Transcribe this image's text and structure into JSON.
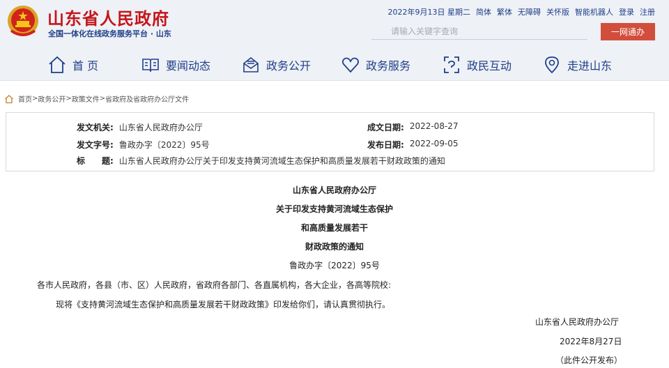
{
  "header": {
    "site_title": "山东省人民政府",
    "site_subtitle": "全国一体化在线政务服务平台 · 山东",
    "top_links": {
      "date": "2022年9月13日 星期二",
      "simplified": "简体",
      "traditional": "繁体",
      "accessible": "无障碍",
      "care": "关怀版",
      "robot": "智能机器人",
      "login": "登录",
      "register": "注册"
    },
    "search": {
      "placeholder": "请输入关键字查询",
      "button_label": "一网通办"
    }
  },
  "nav": {
    "items": [
      {
        "label": "首 页",
        "icon": "home-icon"
      },
      {
        "label": "要闻动态",
        "icon": "book-icon"
      },
      {
        "label": "政务公开",
        "icon": "inbox-icon"
      },
      {
        "label": "政务服务",
        "icon": "heart-icon"
      },
      {
        "label": "政民互动",
        "icon": "interaction-icon"
      },
      {
        "label": "走进山东",
        "icon": "location-icon"
      }
    ]
  },
  "breadcrumb": {
    "items": [
      "首页",
      "政务公开",
      "政策文件",
      "省政府及省政府办公厅文件"
    ],
    "separator": ">"
  },
  "meta": {
    "issuer_label": "发文机关:",
    "issuer": "山东省人民政府办公厅",
    "doc_no_label": "发文字号:",
    "doc_no": "鲁政办字〔2022〕95号",
    "title_label": "标　　题:",
    "title": "山东省人民政府办公厅关于印发支持黄河流域生态保护和高质量发展若干财政政策的通知",
    "created_label": "成文日期:",
    "created": "2022-08-27",
    "published_label": "发布日期:",
    "published": "2022-09-05"
  },
  "document": {
    "title_lines": [
      "山东省人民政府办公厅",
      "关于印发支持黄河流域生态保护",
      "和高质量发展若干",
      "财政政策的通知"
    ],
    "doc_no": "鲁政办字〔2022〕95号",
    "recipients": "各市人民政府，各县（市、区）人民政府，省政府各部门、各直属机构，各大企业，各高等院校:",
    "body": "现将《支持黄河流域生态保护和高质量发展若干财政政策》印发给你们，请认真贯彻执行。",
    "signature": "山东省人民政府办公厅",
    "date": "2022年8月27日",
    "note": "（此件公开发布）"
  },
  "colors": {
    "brand_red": "#c4161c",
    "brand_blue": "#1f3f88",
    "button_red": "#d24e3c",
    "header_bg": "#eef1f6"
  }
}
